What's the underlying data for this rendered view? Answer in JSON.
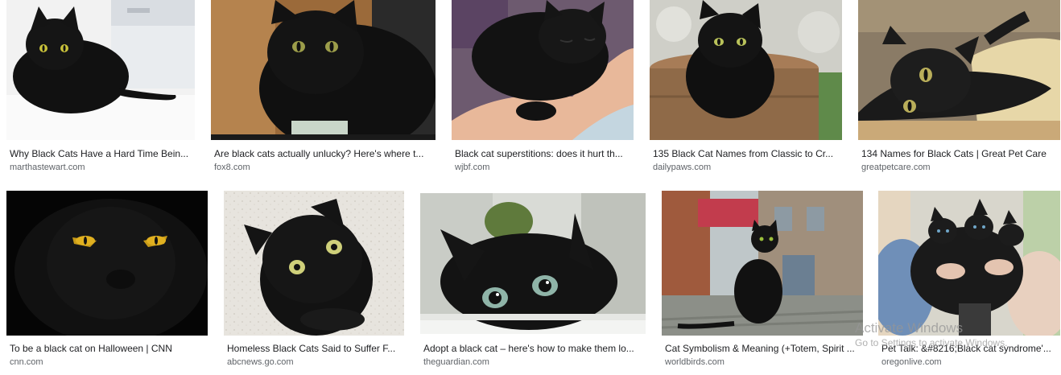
{
  "results": [
    {
      "caption": "Why Black Cats Have a Hard Time Bein...",
      "source": "marthastewart.com",
      "image": "black-cat-on-white-table"
    },
    {
      "caption": "Are black cats actually unlucky? Here's where t...",
      "source": "fox8.com",
      "image": "black-cat-wooden-wall"
    },
    {
      "caption": "Black cat superstitions: does it hurt th...",
      "source": "wjbf.com",
      "image": "black-kitten-held-in-arm"
    },
    {
      "caption": "135 Black Cat Names from Classic to Cr...",
      "source": "dailypaws.com",
      "image": "black-cat-on-tree-stump"
    },
    {
      "caption": "134 Names for Black Cats | Great Pet Care",
      "source": "greatpetcare.com",
      "image": "black-cat-lying-on-cushion"
    },
    {
      "caption": "To be a black cat on Halloween | CNN",
      "source": "cnn.com",
      "image": "black-cat-yellow-eyes-dark"
    },
    {
      "caption": "Homeless Black Cats Said to Suffer F...",
      "source": "abcnews.go.com",
      "image": "black-cat-looking-up"
    },
    {
      "caption": "Adopt a black cat – here's how to make them lo...",
      "source": "theguardian.com",
      "image": "black-cat-peeking-over-edge"
    },
    {
      "caption": "Cat Symbolism & Meaning (+Totem, Spirit ...",
      "source": "worldbirds.com",
      "image": "black-cat-sitting-on-roof"
    },
    {
      "caption": "Pet Talk: &#8216;Black cat syndrome'...",
      "source": "oregonlive.com",
      "image": "person-holding-black-kittens"
    }
  ],
  "watermark": {
    "line1": "Activate Windows",
    "line2": "Go to Settings to activate Windows."
  }
}
